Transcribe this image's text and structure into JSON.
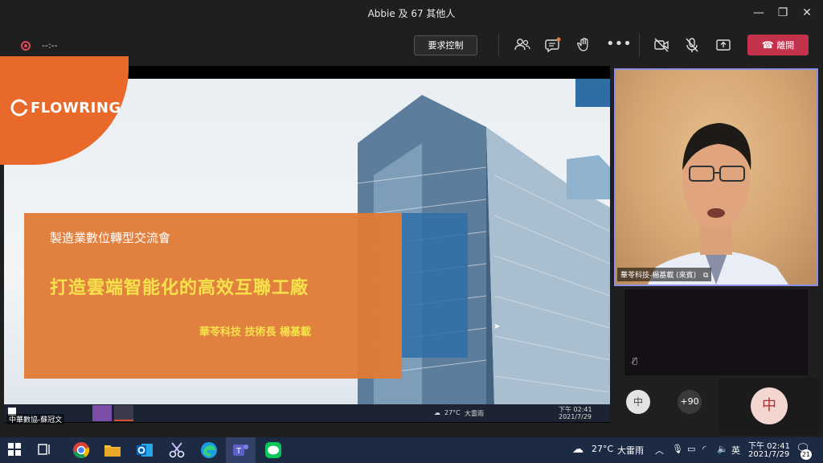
{
  "window": {
    "title": "Abbie 及 67 其他人"
  },
  "toolbar": {
    "timer": "--:--",
    "request_control": "要求控制",
    "leave": "離開"
  },
  "slide": {
    "logo": "FLOWRING",
    "subtitle": "製造業數位轉型交流會",
    "title": "打造雲端智能化的高效互聯工廠",
    "author": "華苓科技 技術長 楊基載"
  },
  "shared_screen": {
    "presenter_caption": "中華數協-蘇冠文",
    "weather": "27°C",
    "weather_desc": "大雷雨",
    "time": "下午 02:41",
    "date": "2021/7/29"
  },
  "participants": {
    "main_video_label": "華苓科技-楊基載 (來賓)",
    "avatar_initial": "中",
    "more_count": "+90",
    "self_initial": "中"
  },
  "taskbar": {
    "weather": "27°C",
    "weather_desc": "大雷雨",
    "ime": "英",
    "time": "下午 02:41",
    "date": "2021/7/29",
    "notifications": "21"
  },
  "colors": {
    "leave_red": "#c4314b",
    "accent_orange": "#e07a35",
    "title_yellow": "#f6e24a",
    "taskbar": "#1d2a44"
  }
}
